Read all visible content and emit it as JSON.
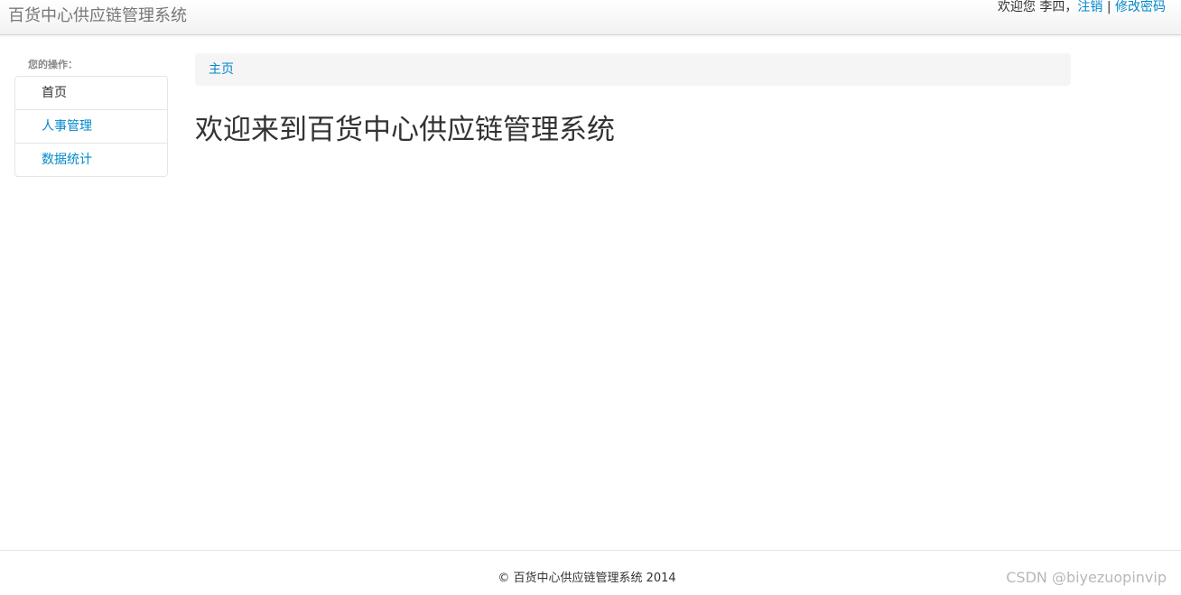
{
  "header": {
    "app_title": "百货中心供应链管理系统",
    "greeting": "欢迎您 李四，",
    "logout_label": "注销",
    "separator": "|",
    "change_password_label": "修改密码"
  },
  "sidebar": {
    "header": "您的操作：",
    "items": [
      {
        "label": "首页"
      },
      {
        "label": "人事管理"
      },
      {
        "label": "数据统计"
      }
    ]
  },
  "breadcrumb": {
    "home_label": "主页"
  },
  "main": {
    "welcome_heading": "欢迎来到百货中心供应链管理系统"
  },
  "footer": {
    "copyright": "© 百货中心供应链管理系统 2014",
    "watermark": "CSDN @biyezuopinvip"
  },
  "colors": {
    "link": "#0088cc",
    "text": "#333333",
    "breadcrumb_bg": "#f5f5f5"
  }
}
